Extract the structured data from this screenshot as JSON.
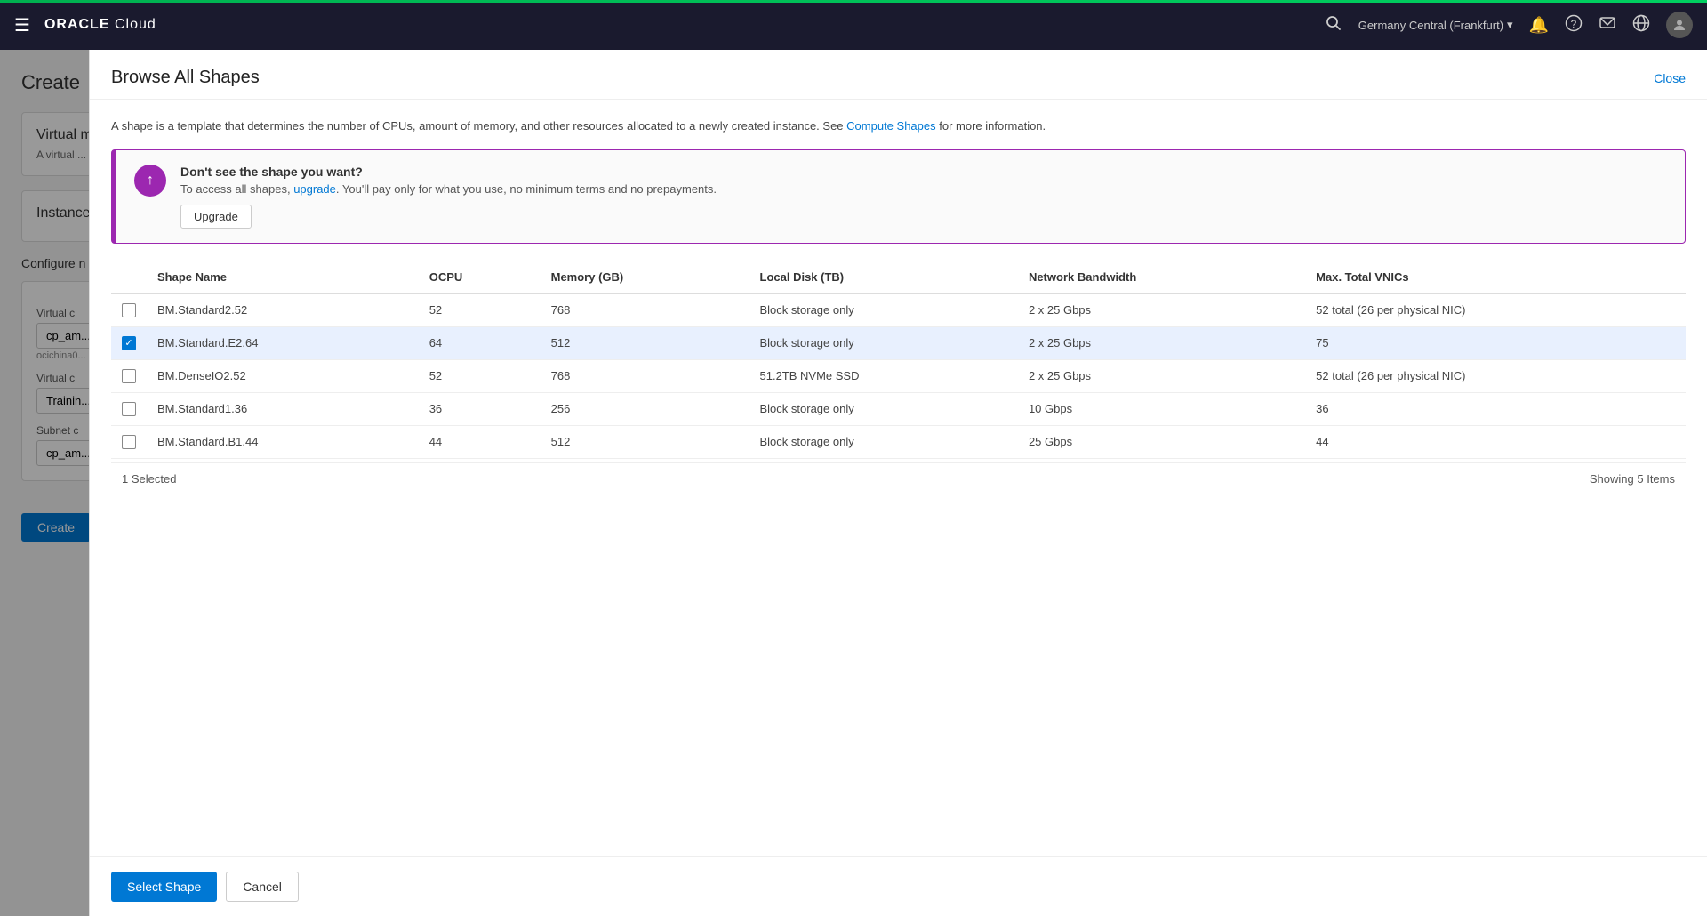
{
  "topAccent": true,
  "nav": {
    "hamburger_icon": "☰",
    "logo_prefix": "ORACLE",
    "logo_suffix": "Cloud",
    "region": "Germany Central (Frankfurt)",
    "region_chevron": "▾",
    "icons": [
      "🔔",
      "?",
      "💬",
      "🌐"
    ],
    "avatar_label": "👤"
  },
  "bgPage": {
    "title": "Create",
    "sections": [
      {
        "id": "virtual-machine",
        "title": "Virtual m...",
        "desc": "A virtual ... runs on ..."
      },
      {
        "id": "instance-shape",
        "title": "Instance Sh..."
      }
    ],
    "configure_label": "Configure n",
    "fields": [
      {
        "label": "Virtual c",
        "value": "cp_am...",
        "sub": "ocichina0..."
      },
      {
        "label": "Virtual c",
        "value": "Trainin..."
      },
      {
        "label": "Subnet c",
        "value": "cp_am..."
      }
    ],
    "create_button": "Create"
  },
  "modal": {
    "title": "Browse All Shapes",
    "close_label": "Close",
    "info_text": "A shape is a template that determines the number of CPUs, amount of memory, and other resources allocated to a newly created instance. See ",
    "info_link_text": "Compute Shapes",
    "info_text_suffix": " for more information.",
    "banner": {
      "icon": "↑",
      "title": "Don't see the shape you want?",
      "desc_prefix": "To access all shapes, ",
      "upgrade_link": "upgrade",
      "desc_suffix": ". You'll pay only for what you use, no minimum terms and no prepayments.",
      "button_label": "Upgrade"
    },
    "table": {
      "columns": [
        "Shape Name",
        "OCPU",
        "Memory (GB)",
        "Local Disk (TB)",
        "Network Bandwidth",
        "Max. Total VNICs"
      ],
      "rows": [
        {
          "selected": false,
          "name": "BM.Standard2.52",
          "ocpu": "52",
          "memory": "768",
          "disk": "Block storage only",
          "bandwidth": "2 x 25 Gbps",
          "vnics": "52 total (26 per physical NIC)"
        },
        {
          "selected": true,
          "name": "BM.Standard.E2.64",
          "ocpu": "64",
          "memory": "512",
          "disk": "Block storage only",
          "bandwidth": "2 x 25 Gbps",
          "vnics": "75"
        },
        {
          "selected": false,
          "name": "BM.DenseIO2.52",
          "ocpu": "52",
          "memory": "768",
          "disk": "51.2TB NVMe SSD",
          "bandwidth": "2 x 25 Gbps",
          "vnics": "52 total (26 per physical NIC)"
        },
        {
          "selected": false,
          "name": "BM.Standard1.36",
          "ocpu": "36",
          "memory": "256",
          "disk": "Block storage only",
          "bandwidth": "10 Gbps",
          "vnics": "36"
        },
        {
          "selected": false,
          "name": "BM.Standard.B1.44",
          "ocpu": "44",
          "memory": "512",
          "disk": "Block storage only",
          "bandwidth": "25 Gbps",
          "vnics": "44"
        }
      ],
      "selected_count": "1 Selected",
      "showing_label": "Showing 5 Items"
    },
    "actions": {
      "select_shape": "Select Shape",
      "cancel": "Cancel"
    }
  }
}
